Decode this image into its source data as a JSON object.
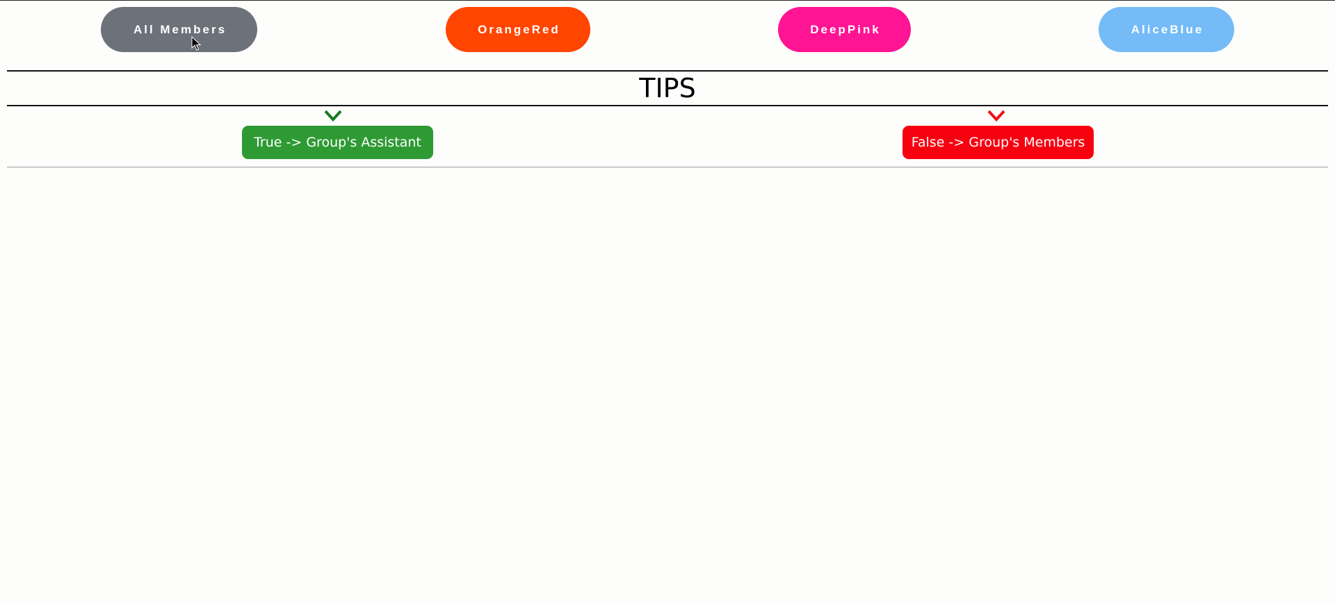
{
  "filters": [
    {
      "label": "All Members",
      "color": "#6c717a"
    },
    {
      "label": "OrangeRed",
      "color": "#ff4500"
    },
    {
      "label": "DeepPink",
      "color": "#ff1493"
    },
    {
      "label": "AliceBlue",
      "color": "#74bbf7"
    }
  ],
  "tips": {
    "title": "TIPS",
    "true_tip": {
      "label": "True -> Group's Assistant",
      "color": "#2e9a34",
      "arrow_color": "#157a1f"
    },
    "false_tip": {
      "label": "False -> Group's Members",
      "color": "#f70010",
      "arrow_color": "#ee1111"
    }
  },
  "icons": {
    "cursor": "mouse-pointer-icon",
    "true_arrow": "chevron-down-icon",
    "false_arrow": "chevron-down-icon"
  }
}
